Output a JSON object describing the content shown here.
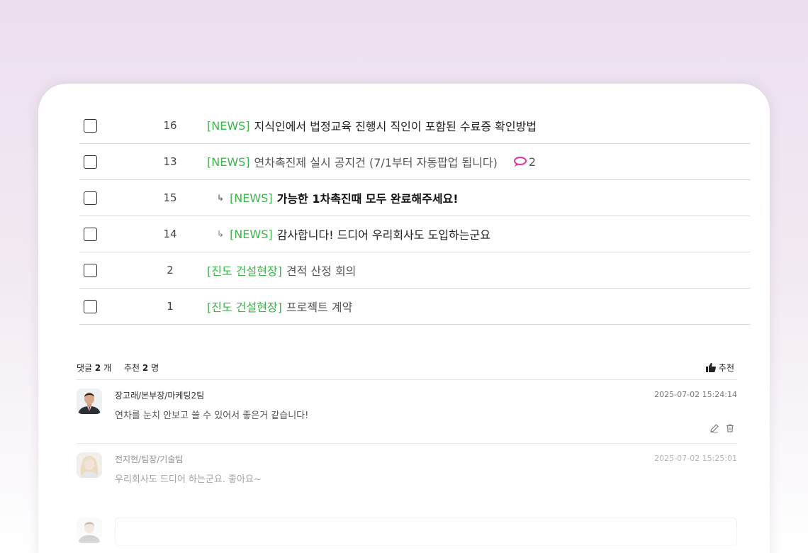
{
  "posts": [
    {
      "num": "16",
      "category": "[NEWS]",
      "title": "지식인에서 법정교육 진행시 직인이 포함된 수료증 확인방법",
      "style": "normal"
    },
    {
      "num": "13",
      "category": "[NEWS]",
      "title": "연차촉진제 실시 공지건 (7/1부터 자동팝업 됩니다)",
      "comments": "2",
      "style": "light"
    },
    {
      "num": "15",
      "reply_mark": "↳",
      "category": "[NEWS]",
      "title": "가능한 1차촉진때 모두 완료해주세요!",
      "style": "bold"
    },
    {
      "num": "14",
      "reply_mark": "↳",
      "category": "[NEWS]",
      "title": "감사합니다! 드디어 우리회사도 도입하는군요",
      "style": "normal"
    },
    {
      "num": "2",
      "category": "[진도 건설현장]",
      "title": "견적 산정 회의",
      "style": "light"
    },
    {
      "num": "1",
      "category": "[진도 건설현장]",
      "title": "프로젝트 계약",
      "style": "light"
    }
  ],
  "comment_summary": {
    "comment_prefix": "댓글",
    "comment_count": "2",
    "comment_unit": "개",
    "recommend_prefix": "추천",
    "recommend_count": "2",
    "recommend_unit": "명"
  },
  "recommend_button": {
    "label": "추천",
    "icon": "thumbs-up-icon"
  },
  "comments": [
    {
      "author": "장고래/본부장/마케팅2팀",
      "date": "2025-07-02 15:24:14",
      "text": "연차를 눈치 안보고 쓸 수 있어서 좋은거 같습니다!",
      "tools": [
        "edit-icon",
        "trash-icon"
      ]
    },
    {
      "author": "전지현/팀장/기술팀",
      "date": "2025-07-02 15:25:01",
      "text": "우리회사도 드디어 하는군요. 좋아요~"
    }
  ],
  "colors": {
    "category": "#3cb54a",
    "comment_icon": "#e0339a",
    "card_bg": "#ffffff",
    "page_bg": "#ecdfef"
  }
}
